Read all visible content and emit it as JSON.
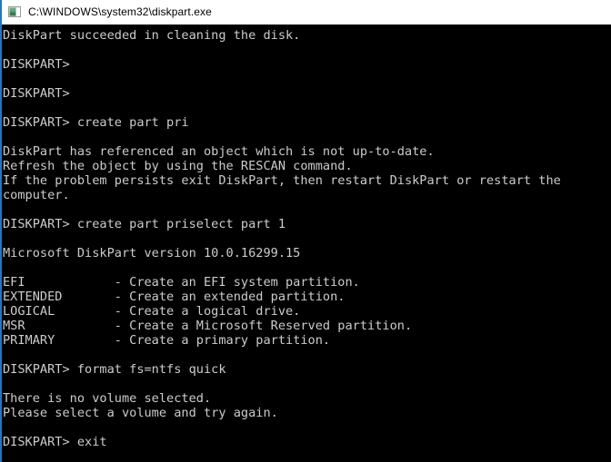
{
  "window": {
    "title": "C:\\WINDOWS\\system32\\diskpart.exe",
    "icon": "console-window-icon",
    "accent_color": "#1e78c8",
    "titlebar_bg": "#ffffff",
    "titlebar_fg": "#000000"
  },
  "console": {
    "background_color": "#000000",
    "text_color": "#cccccc",
    "lines": [
      "DiskPart succeeded in cleaning the disk.",
      "",
      "DISKPART>",
      "",
      "DISKPART>",
      "",
      "DISKPART> create part pri",
      "",
      "DiskPart has referenced an object which is not up-to-date.",
      "Refresh the object by using the RESCAN command.",
      "If the problem persists exit DiskPart, then restart DiskPart or restart the",
      "computer.",
      "",
      "DISKPART> create part priselect part 1",
      "",
      "Microsoft DiskPart version 10.0.16299.15",
      "",
      "EFI            - Create an EFI system partition.",
      "EXTENDED       - Create an extended partition.",
      "LOGICAL        - Create a logical drive.",
      "MSR            - Create a Microsoft Reserved partition.",
      "PRIMARY        - Create a primary partition.",
      "",
      "DISKPART> format fs=ntfs quick",
      "",
      "There is no volume selected.",
      "Please select a volume and try again.",
      "",
      "DISKPART> exit"
    ]
  }
}
